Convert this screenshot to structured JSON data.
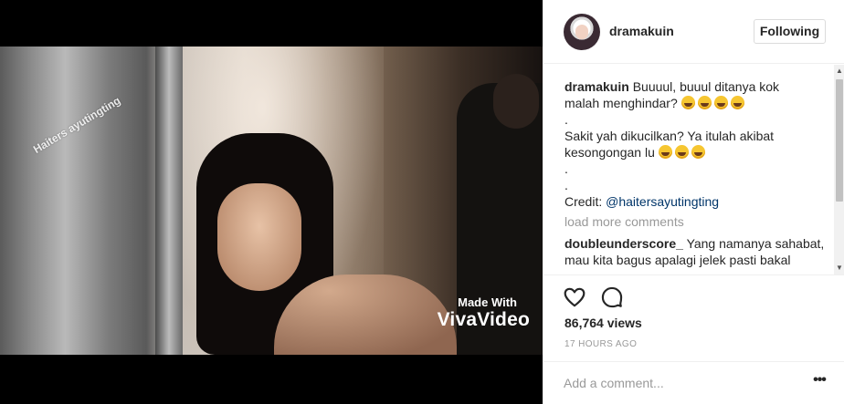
{
  "video": {
    "watermark_text": "Haiters ayutingting",
    "made_with_line": "Made With",
    "made_with_brand": "VivaVideo"
  },
  "post": {
    "username": "dramakuin",
    "follow_label": "Following",
    "caption": {
      "username": "dramakuin",
      "line1": "Buuuul, buuul ditanya kok",
      "line2": "malah menghindar?",
      "dot1": ".",
      "line3": "Sakit yah dikucilkan? Ya itulah akibat",
      "line4": "kesongongan lu",
      "dot2": ".",
      "dot3": ".",
      "credit_label": "Credit:",
      "credit_mention": "@haitersayutingting",
      "emoji_icon": "face-with-tears-of-joy-emoji"
    },
    "load_more_label": "load more comments",
    "comments": [
      {
        "username": "doubleunderscore_",
        "text_line1": "Yang namanya sahabat,",
        "text_line2": "mau kita bagus apalagi jelek pasti bakal"
      }
    ],
    "views": "86,764 views",
    "timestamp": "17 HOURS AGO",
    "comment_placeholder": "Add a comment...",
    "more_label": "•••",
    "icons": {
      "like": "heart-icon",
      "comment": "speech-bubble-icon"
    }
  }
}
